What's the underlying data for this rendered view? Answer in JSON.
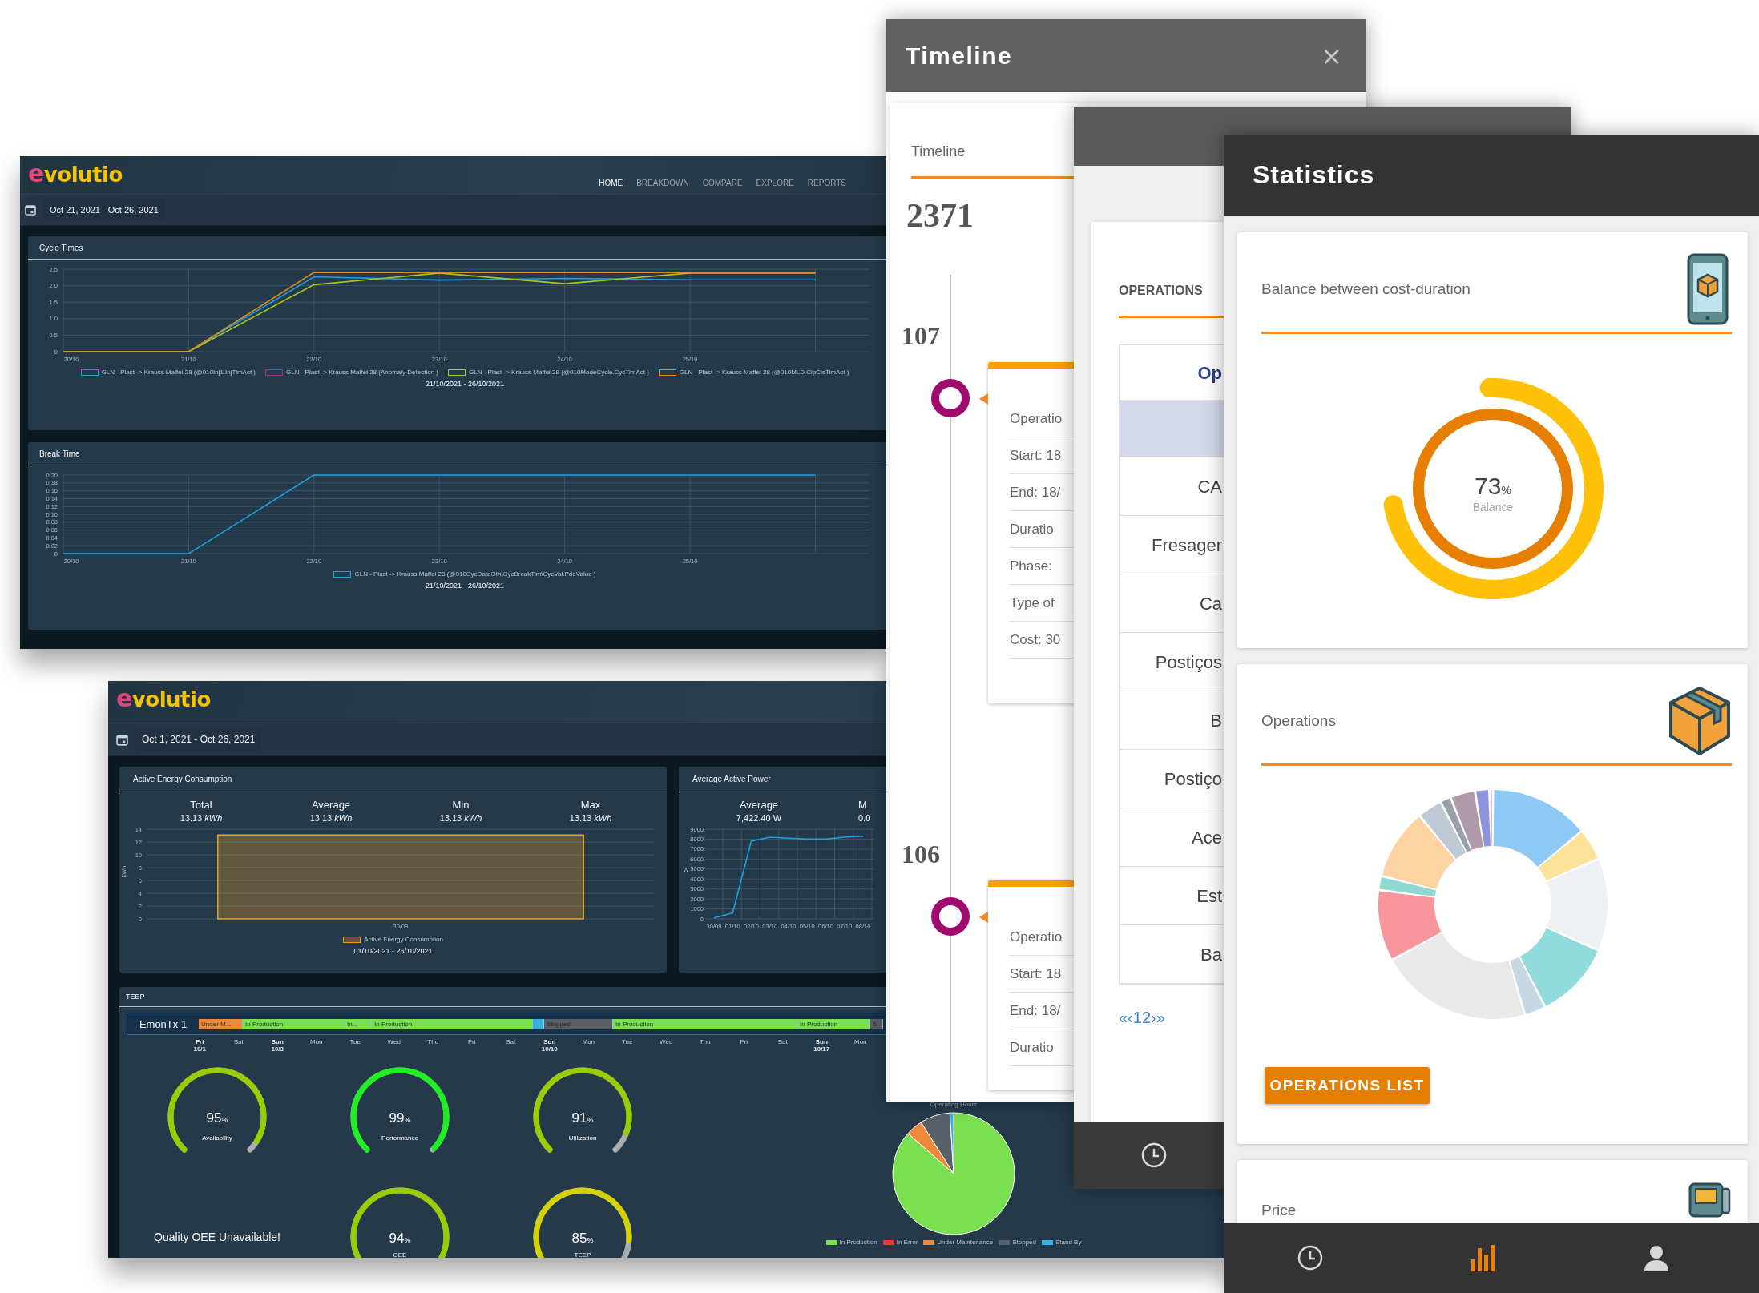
{
  "dashboard": {
    "logo": "evolutio",
    "nav": [
      {
        "label": "HOME",
        "selected": true
      },
      {
        "label": "BREAKDOWN",
        "selected": false
      },
      {
        "label": "COMPARE",
        "selected": false
      },
      {
        "label": "EXPLORE",
        "selected": false
      },
      {
        "label": "REPORTS",
        "selected": false
      }
    ],
    "date_range": "Oct 21, 2021 - Oct 26, 2021",
    "panels": [
      {
        "title": "Cycle Times",
        "chart_data": {
          "type": "line",
          "grid": true,
          "xlabel": "21/10/2021 - 26/10/2021",
          "categories": [
            "20/10",
            "21/10",
            "22/10",
            "23/10",
            "24/10",
            "25/10",
            null
          ],
          "ylim": [
            0,
            2.5
          ],
          "yticks": [
            {
              "value": 0,
              "label": "0"
            },
            {
              "value": 0.5,
              "label": "0.5"
            },
            {
              "value": 1,
              "label": "1.0"
            },
            {
              "value": 1.5,
              "label": "1.5"
            },
            {
              "value": 2,
              "label": "2.0"
            },
            {
              "value": 2.5,
              "label": "2.5"
            }
          ],
          "series": [
            {
              "name": "GLN - Plast -> Krauss Maffei 28 (@010Inj1.InjTimAct )",
              "color": "#1e9fe0",
              "values": [
                0,
                0,
                2.27,
                2.17,
                2.22,
                2.18,
                2.18
              ]
            },
            {
              "name": "GLN - Plast -> Krauss Maffei 28 (Anomaly Detection )",
              "color": "#9b30a0",
              "values": [
                null,
                null,
                null,
                null,
                null,
                null,
                null
              ]
            },
            {
              "name": "GLN - Plast -> Krauss Maffei 28 (@010ModeCycle.CycTimAct )",
              "color": "#a8c81a",
              "values": [
                0,
                0,
                2.03,
                2.38,
                2.06,
                2.38,
                2.38
              ]
            },
            {
              "name": "GLN - Plast -> Krauss Maffei 28 (@010MLD.ClpClsTimAct )",
              "color": "#e08a1a",
              "values": [
                0,
                0,
                2.4,
                2.4,
                2.4,
                2.4,
                2.4
              ]
            }
          ]
        }
      },
      {
        "title": "Break Time",
        "chart_data": {
          "type": "line",
          "grid": true,
          "xlabel": "21/10/2021 - 26/10/2021",
          "categories": [
            "20/10",
            "21/10",
            "22/10",
            "23/10",
            "24/10",
            "25/10",
            null
          ],
          "ylim": [
            0,
            0.2
          ],
          "yticks": [
            {
              "value": 0,
              "label": "0"
            },
            {
              "value": 0.02,
              "label": "0.02"
            },
            {
              "value": 0.04,
              "label": "0.04"
            },
            {
              "value": 0.06,
              "label": "0.06"
            },
            {
              "value": 0.08,
              "label": "0.08"
            },
            {
              "value": 0.1,
              "label": "0.10"
            },
            {
              "value": 0.12,
              "label": "0.12"
            },
            {
              "value": 0.14,
              "label": "0.14"
            },
            {
              "value": 0.16,
              "label": "0.16"
            },
            {
              "value": 0.18,
              "label": "0.18"
            },
            {
              "value": 0.2,
              "label": "0.20"
            }
          ],
          "series": [
            {
              "name": "GLN - Plast -> Krauss Maffei 28 (@010CycDataOth\\CycBreakTim\\CycVal.PdeValue )",
              "color": "#1e9fe0",
              "values": [
                0,
                0,
                0.2,
                0.2,
                0.2,
                0.2,
                0.2
              ]
            }
          ]
        }
      }
    ]
  },
  "energy_dashboard": {
    "logo": "evolutio",
    "date_range": "Oct 1, 2021 - Oct 26, 2021",
    "energy_panel": {
      "title": "Active Energy Consumption",
      "stats": [
        {
          "label": "Total",
          "value": "13.13 *kWh*"
        },
        {
          "label": "Average",
          "value": "13.13 *kWh*"
        },
        {
          "label": "Min",
          "value": "13.13 *kWh*"
        },
        {
          "label": "Max",
          "value": "13.13 *kWh*"
        }
      ],
      "chart_data": {
        "type": "bar",
        "grid": true,
        "xlabel": "01/10/2021 - 26/10/2021",
        "ylabel": "kWh",
        "categories": [
          "30/09"
        ],
        "ylim": [
          0,
          14
        ],
        "yticks": [
          0,
          2,
          4,
          6,
          8,
          10,
          12,
          14
        ],
        "series": [
          {
            "name": "Active Energy Consumption",
            "color": "#e8a020",
            "values": [
              13.1
            ]
          }
        ]
      }
    },
    "power_panel": {
      "title": "Average Active Power",
      "stats": [
        {
          "label": "Average",
          "value": "7,422.40 W"
        },
        {
          "label": "M",
          "value": "0.0"
        }
      ],
      "chart_data": {
        "type": "line",
        "grid": true,
        "ylabel": "W",
        "categories": [
          "30/09",
          "01/10",
          "02/10",
          "03/10",
          "04/10",
          "05/10",
          "06/10",
          "07/10",
          "08/10"
        ],
        "ylim": [
          0,
          9000
        ],
        "yticks": [
          0,
          1000,
          2000,
          3000,
          4000,
          5000,
          6000,
          7000,
          8000,
          9000
        ],
        "series": [
          {
            "color": "#1e9fe0",
            "values": [
              100,
              600,
              7800,
              8200,
              8100,
              8000,
              8000,
              8200,
              8300
            ]
          }
        ]
      }
    },
    "teep": {
      "title": "TEEP",
      "machine": "EmonTx 1",
      "segments": [
        {
          "label": "Under M...",
          "color": "#f08a3a"
        },
        {
          "label": "In Production",
          "color": "#7be04f"
        },
        {
          "label": "In...",
          "color": "#7be04f"
        },
        {
          "label": "In Production",
          "color": "#7be04f"
        },
        {
          "color": "#3ab0e0"
        },
        {
          "label": "Stopped",
          "color": "#5a6068"
        },
        {
          "label": "In Production",
          "color": "#7be04f"
        },
        {
          "label": "In Production",
          "color": "#7be04f"
        },
        {
          "label": "S",
          "color": "#5a6068"
        }
      ],
      "days": [
        {
          "day": "Fri",
          "date": "10/1"
        },
        {
          "day": "Sat"
        },
        {
          "day": "Sun",
          "date": "10/3"
        },
        {
          "day": "Mon"
        },
        {
          "day": "Tue"
        },
        {
          "day": "Wed"
        },
        {
          "day": "Thu"
        },
        {
          "day": "Fri"
        },
        {
          "day": "Sat"
        },
        {
          "day": "Sun",
          "date": "10/10"
        },
        {
          "day": "Mon"
        },
        {
          "day": "Tue"
        },
        {
          "day": "Wed"
        },
        {
          "day": "Thu"
        },
        {
          "day": "Fri"
        },
        {
          "day": "Sat"
        },
        {
          "day": "Sun",
          "date": "10/17"
        },
        {
          "day": "Mon"
        }
      ],
      "gauges": [
        {
          "value": "95",
          "unit": "%",
          "label": "Availability"
        },
        {
          "value": "99",
          "unit": "%",
          "label": "Performance"
        },
        {
          "value": "91",
          "unit": "%",
          "label": "Utilization"
        },
        {
          "value": "94",
          "unit": "%",
          "label": "OEE"
        },
        {
          "value": "85",
          "unit": "%",
          "label": "TEEP"
        }
      ],
      "quality_note": "Quality OEE Unavailable!",
      "pie": {
        "title": "Operating Hours",
        "legend": [
          {
            "label": "In Production",
            "color": "#7be04f"
          },
          {
            "label": "In Error",
            "color": "#e23a3a"
          },
          {
            "label": "Under Maintenance",
            "color": "#f08a3a"
          },
          {
            "label": "Stopped",
            "color": "#5a6068"
          },
          {
            "label": "Stand By",
            "color": "#3ab0e0"
          }
        ]
      }
    }
  },
  "timeline_window": {
    "title": "Timeline",
    "close": "×",
    "card_title": "Timeline",
    "total": "2371",
    "entries": [
      {
        "number": "107",
        "rows": [
          "Operatio",
          "Start: 18",
          "End: 18/",
          "Duratio",
          "Phase:",
          "Type of",
          "Cost: 30"
        ]
      },
      {
        "number": "106",
        "rows": [
          "Operatio",
          "Start: 18",
          "End: 18/",
          "Duratio"
        ]
      }
    ]
  },
  "operations_window": {
    "heading": "OPERATIONS",
    "column": "Op",
    "rows": [
      {
        "selected": true
      },
      {
        "label": "CA",
        "selected": false
      },
      {
        "label": "Fresager",
        "selected": false
      },
      {
        "label": "Ca",
        "selected": false
      },
      {
        "label": "Postiços",
        "selected": false
      },
      {
        "label": "B",
        "selected": false
      },
      {
        "label": "Postiço",
        "selected": false
      },
      {
        "label": "Ace",
        "selected": false
      },
      {
        "label": "Est",
        "selected": false
      },
      {
        "label": "Ba",
        "selected": false
      }
    ],
    "pagination": "«‹12›»"
  },
  "statistics_window": {
    "title": "Statistics",
    "cards": [
      {
        "kind": "gauge",
        "title": "Balance between cost-duration",
        "value": "73",
        "unit": "%",
        "label": "Balance"
      },
      {
        "kind": "donut",
        "title": "Operations",
        "button": "OPERATIONS LIST"
      },
      {
        "kind": "plain",
        "title": "Price"
      }
    ],
    "nav": [
      {
        "kind": "clock",
        "selected": false
      },
      {
        "kind": "chart",
        "selected": true
      },
      {
        "kind": "person",
        "selected": false
      }
    ]
  }
}
